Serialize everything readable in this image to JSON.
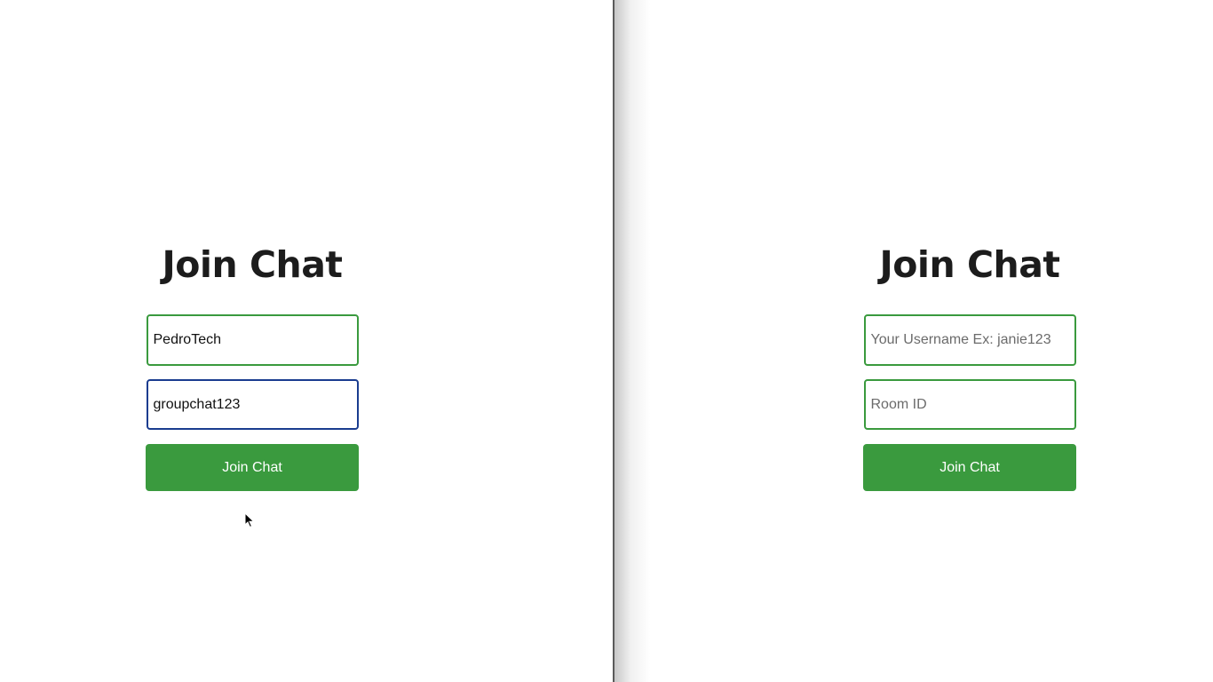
{
  "left_window": {
    "title": "Join Chat",
    "username": {
      "value": "PedroTech",
      "placeholder": "Your Username Ex: janie123"
    },
    "room": {
      "value": "groupchat123",
      "placeholder": "Room ID"
    },
    "join_label": "Join Chat"
  },
  "right_window": {
    "title": "Join Chat",
    "username": {
      "value": "",
      "placeholder": "Your Username Ex: janie123"
    },
    "room": {
      "value": "",
      "placeholder": "Room ID"
    },
    "join_label": "Join Chat"
  },
  "colors": {
    "accent_green": "#3a9a3e",
    "focus_border": "#1a3c8f",
    "title_text": "#1c1c1c"
  },
  "cursor_icon": "arrow-cursor-icon"
}
